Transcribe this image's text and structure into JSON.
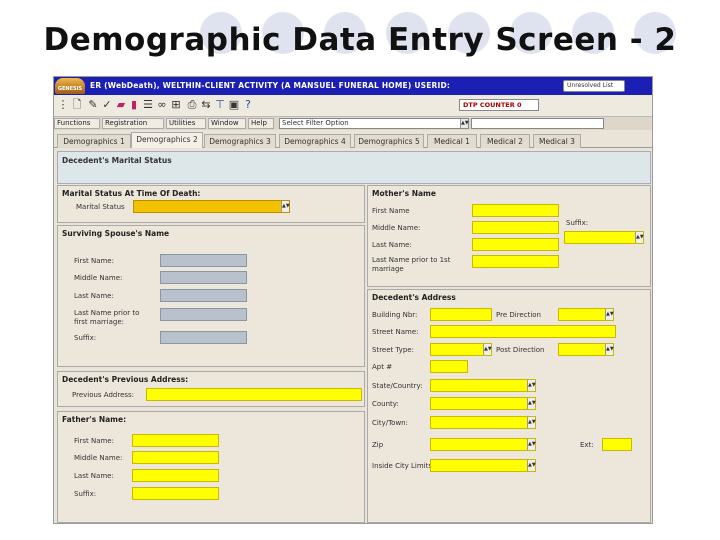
{
  "slide": {
    "title": "Demographic Data Entry Screen - 2"
  },
  "titlebar": {
    "logo_text": "GENESIS",
    "text": "ER (WebDeath), WELTHIN-CLIENT ACTIVITY (A MANSUEL FUNERAL HOME) USERID:",
    "dropdown": "Unresolved List"
  },
  "toolbar": {
    "counter_field": "DTP COUNTER 0"
  },
  "menubar": {
    "items": [
      "Functions",
      "Registration",
      "Utilities",
      "Window",
      "Help"
    ],
    "filter_select": "Select Filter Option"
  },
  "tabs": [
    "Demographics 1",
    "Demographics 2",
    "Demographics 3",
    "Demographics 4",
    "Demographics 5",
    "Medical 1",
    "Medical 2",
    "Medical 3"
  ],
  "banner": {
    "title": "Decedent's Marital Status"
  },
  "marital": {
    "title": "Marital Status At Time Of Death:",
    "label": "Marital Status"
  },
  "spouse": {
    "title": "Surviving Spouse's Name",
    "first": "First Name:",
    "middle": "Middle Name:",
    "last": "Last Name:",
    "prior1": "Last Name prior to",
    "prior2": "first marriage:",
    "suffix": "Suffix:"
  },
  "previous": {
    "title": "Decedent's Previous Address:",
    "label": "Previous Address:"
  },
  "father": {
    "title": "Father's Name:",
    "first": "First Name:",
    "middle": "Middle Name:",
    "last": "Last Name:",
    "suffix": "Suffix:"
  },
  "mother": {
    "title": "Mother's Name",
    "first": "First Name",
    "middle": "Middle Name:",
    "last": "Last Name:",
    "prior1": "Last Name prior to 1st",
    "prior2": "marriage",
    "suffix": "Suffix:"
  },
  "address": {
    "title": "Decedent's Address",
    "building": "Building Nbr:",
    "pre_direction": "Pre Direction",
    "street_name": "Street Name:",
    "street_type": "Street Type:",
    "post_direction": "Post Direction",
    "apt": "Apt #",
    "state": "State/Country:",
    "county": "County:",
    "city": "City/Town:",
    "zip": "Zip",
    "ext": "Ext:",
    "inside_city": "Inside City Limits?"
  }
}
